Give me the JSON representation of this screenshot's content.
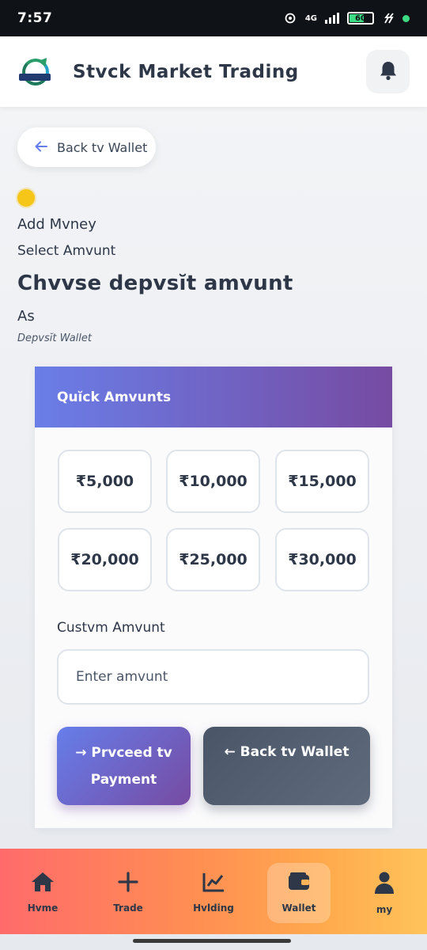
{
  "status_bar": {
    "time": "7:57",
    "network": "4G",
    "battery": "60",
    "colors": {
      "bar": "#0f1217",
      "battery_fill": "#3ddc84"
    }
  },
  "header": {
    "title": "Stvck Market Trading",
    "logo_icon": "stock-logo",
    "notification_icon": "bell-icon"
  },
  "page": {
    "back_pill_label": "Back tv Wallet",
    "heading_add": "Add Mvney",
    "heading_select": "Select Amvunt",
    "heading_choose": "Chvvse depvsĭt amvunt",
    "heading_as": "As",
    "subheading_wallet": "Depvsĭt Wallet"
  },
  "card": {
    "header_title": "Quĭck Amvunts",
    "header_gradient": [
      "#6a7ee8",
      "#764ba2"
    ],
    "amounts": [
      "₹5,000",
      "₹10,000",
      "₹15,000",
      "₹20,000",
      "₹25,000",
      "₹30,000"
    ],
    "custom_label": "Custvm Amvunt",
    "custom_placeholder": "Enter amvunt",
    "proceed_label": "→ Prvceed tv Payment",
    "back_label": "← Back tv Wallet"
  },
  "bottom_nav": {
    "items": [
      {
        "label": "Hvme",
        "icon": "home-icon"
      },
      {
        "label": "Trade",
        "icon": "plus-icon"
      },
      {
        "label": "Hvlding",
        "icon": "chart-line-icon"
      },
      {
        "label": "Wallet",
        "icon": "wallet-icon",
        "active": true
      },
      {
        "label": "my",
        "icon": "user-icon"
      }
    ],
    "gradient": [
      "#ff6b6b",
      "#ff8e53",
      "#ffa94d",
      "#ffc35a"
    ]
  }
}
